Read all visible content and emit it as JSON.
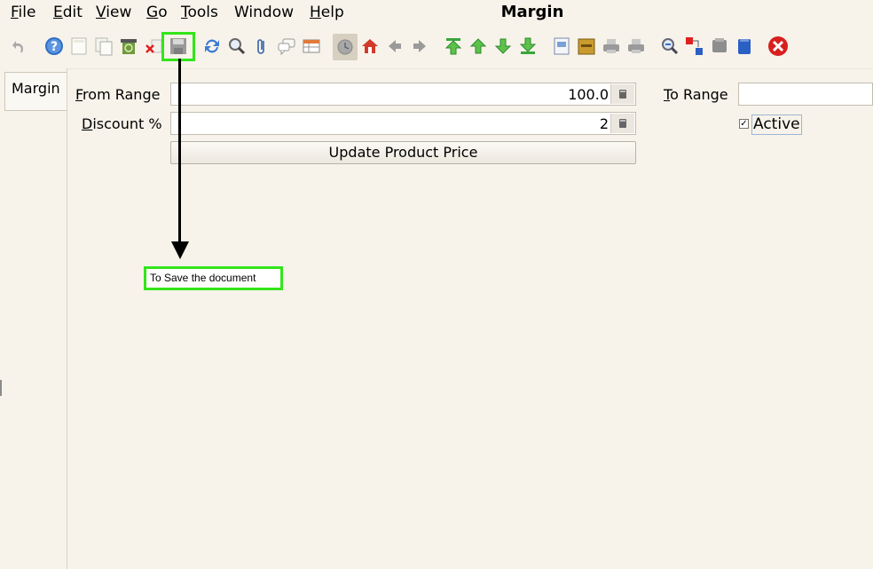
{
  "menubar": {
    "items": [
      {
        "mnemonic": "F",
        "rest": "ile"
      },
      {
        "mnemonic": "E",
        "rest": "dit"
      },
      {
        "mnemonic": "V",
        "rest": "iew"
      },
      {
        "mnemonic": "G",
        "rest": "o"
      },
      {
        "mnemonic": "T",
        "rest": "ools"
      },
      {
        "mnemonic": "",
        "rest": "Window"
      },
      {
        "mnemonic": "H",
        "rest": "elp"
      }
    ],
    "window_title": "Margin"
  },
  "toolbar": {
    "icons": [
      "undo-icon",
      "help-icon",
      "new-record-icon",
      "copy-record-icon",
      "recycle-icon",
      "delete-icon",
      "save-icon",
      "refresh-icon",
      "find-icon",
      "attachment-icon",
      "chat-icon",
      "grid-toggle-icon",
      "history-icon",
      "home-icon",
      "back-icon",
      "forward-icon",
      "first-record-icon",
      "previous-record-icon",
      "next-record-icon",
      "last-record-icon",
      "report-icon",
      "archive-icon",
      "print-preview-icon",
      "print-icon",
      "zoom-across-icon",
      "workflow-icon",
      "product-info-icon",
      "lock-icon",
      "close-window-icon"
    ],
    "highlight_color": "#33e51a"
  },
  "tabs": [
    {
      "label": "Margin"
    }
  ],
  "form": {
    "from_range": {
      "mnemonic": "F",
      "rest": "rom Range",
      "value": "100.0"
    },
    "to_range": {
      "mnemonic": "T",
      "rest": "o Range",
      "value": ""
    },
    "discount": {
      "mnemonic": "D",
      "rest": "iscount %",
      "value": "2"
    },
    "update_button": "Update Product Price",
    "active": {
      "label": "Active",
      "checked": true,
      "mark": "✓"
    }
  },
  "annotation": {
    "text": "To Save the document"
  }
}
